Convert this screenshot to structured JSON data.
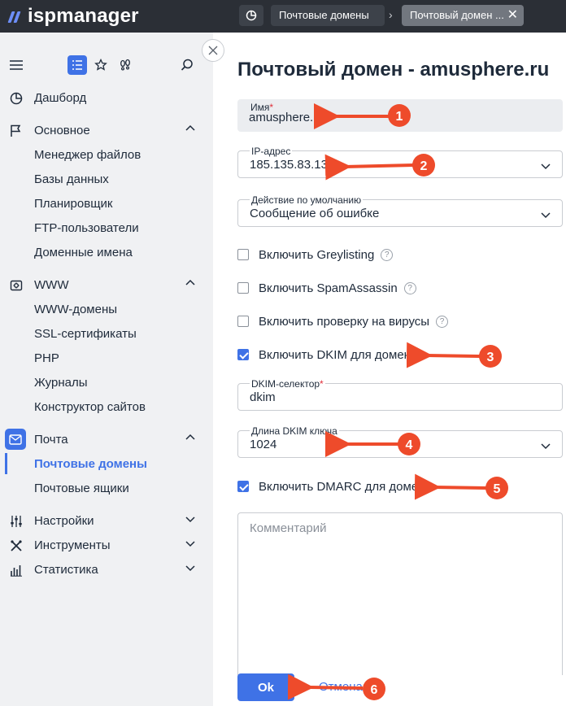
{
  "app": {
    "logo_text": "ispmanager"
  },
  "tabs": [
    {
      "label": "Почтовые домены"
    },
    {
      "label": "Почтовый домен ..."
    }
  ],
  "sidebar": {
    "items": [
      {
        "label": "Дашборд",
        "icon": "dashboard-icon"
      },
      {
        "label": "Основное",
        "icon": "flag-icon"
      },
      {
        "label": "Менеджер файлов"
      },
      {
        "label": "Базы данных"
      },
      {
        "label": "Планировщик"
      },
      {
        "label": "FTP-пользователи"
      },
      {
        "label": "Доменные имена"
      },
      {
        "label": "WWW",
        "icon": "www-gear-icon"
      },
      {
        "label": "WWW-домены"
      },
      {
        "label": "SSL-сертификаты"
      },
      {
        "label": "PHP"
      },
      {
        "label": "Журналы"
      },
      {
        "label": "Конструктор сайтов"
      },
      {
        "label": "Почта",
        "icon": "mail-icon"
      },
      {
        "label": "Почтовые домены"
      },
      {
        "label": "Почтовые ящики"
      },
      {
        "label": "Настройки",
        "icon": "sliders-icon"
      },
      {
        "label": "Инструменты",
        "icon": "tools-icon"
      },
      {
        "label": "Статистика",
        "icon": "stats-icon"
      }
    ]
  },
  "form": {
    "title": "Почтовый домен - amusphere.ru",
    "name": {
      "label": "Имя",
      "required": "*",
      "value": "amusphere.ru"
    },
    "ip": {
      "label": "IP-адрес",
      "value": "185.135.83.132"
    },
    "action": {
      "label": "Действие по умолчанию",
      "value": "Сообщение об ошибке"
    },
    "greylisting": {
      "label": "Включить Greylisting",
      "checked": false
    },
    "spamassassin": {
      "label": "Включить SpamAssassin",
      "checked": false
    },
    "antivirus": {
      "label": "Включить проверку на вирусы",
      "checked": false
    },
    "dkim": {
      "label": "Включить DKIM для домена",
      "checked": true
    },
    "dkim_selector": {
      "label": "DKIM-селектор",
      "required": "*",
      "value": "dkim"
    },
    "dkim_keylen": {
      "label": "Длина DKIM ключа",
      "value": "1024"
    },
    "dmarc": {
      "label": "Включить DMARC для домена",
      "checked": true
    },
    "comment": {
      "placeholder": "Комментарий"
    },
    "ok_label": "Ok",
    "cancel_label": "Отмена",
    "help_glyph": "?"
  },
  "annotations": [
    "1",
    "2",
    "3",
    "4",
    "5",
    "6"
  ],
  "colors": {
    "accent": "#3f72e6",
    "arrow": "#ee4b2b",
    "topbar": "#2b2f36"
  }
}
